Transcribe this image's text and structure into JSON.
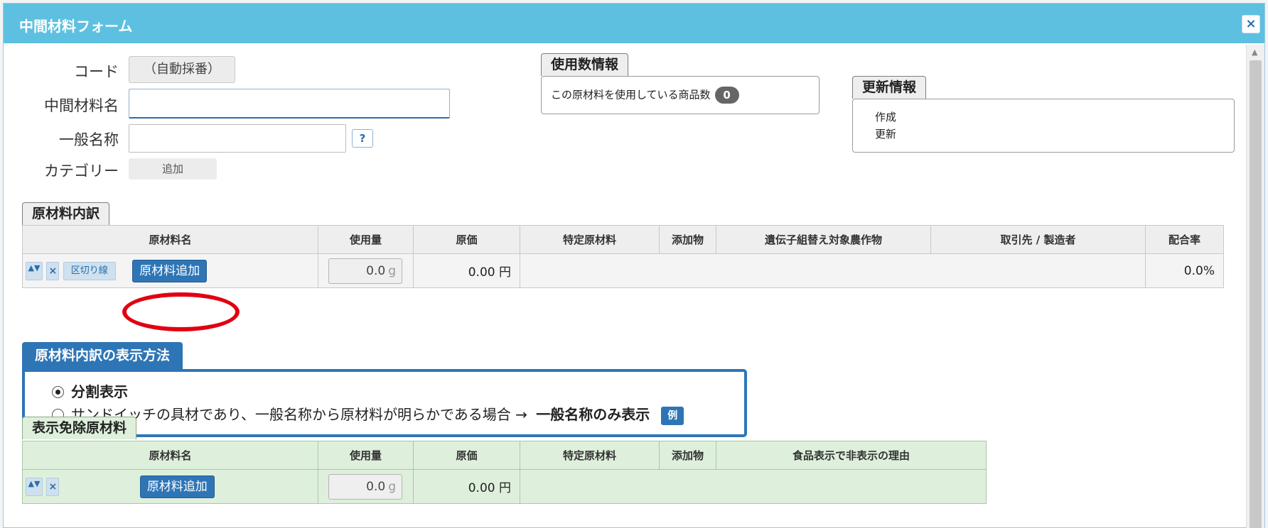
{
  "window": {
    "title": "中間材料フォーム",
    "close_symbol": "×"
  },
  "form": {
    "code_label": "コード",
    "code_value": "（自動採番）",
    "name_label": "中間材料名",
    "name_value": "",
    "general_name_label": "一般名称",
    "general_name_value": "",
    "help_symbol": "?",
    "category_label": "カテゴリー",
    "category_add_label": "追加"
  },
  "usage_info": {
    "tab_label": "使用数情報",
    "text": "この原材料を使用している商品数",
    "count": "0"
  },
  "update_info": {
    "tab_label": "更新情報",
    "created_label": "作成",
    "updated_label": "更新"
  },
  "breakdown": {
    "tab_label": "原材料内訳",
    "columns": [
      "原材料名",
      "使用量",
      "原価",
      "特定原材料",
      "添加物",
      "遺伝子組替え対象農作物",
      "取引先 / 製造者",
      "配合率"
    ],
    "row": {
      "updown_symbol": "▲▼",
      "delete_symbol": "×",
      "separator_label": "区切り線",
      "add_button_label": "原材料追加",
      "qty": "0.0",
      "qty_unit": "g",
      "cost": "0.00 円",
      "ratio": "0.0%"
    }
  },
  "display_method": {
    "tab_label": "原材料内訳の表示方法",
    "option1": "分割表示",
    "option2_text": "サンドイッチの具材であり、一般名称から原材料が明らかである場合 →",
    "option2_bold": "一般名称のみ表示",
    "example_label": "例",
    "selected": 1
  },
  "excluded": {
    "tab_label": "表示免除原材料",
    "columns": [
      "原材料名",
      "使用量",
      "原価",
      "特定原材料",
      "添加物",
      "食品表示で非表示の理由"
    ],
    "row": {
      "updown_symbol": "▲▼",
      "delete_symbol": "×",
      "add_button_label": "原材料追加",
      "qty": "0.0",
      "qty_unit": "g",
      "cost": "0.00 円"
    }
  },
  "annotation": {
    "highlight_color": "#e10012"
  }
}
